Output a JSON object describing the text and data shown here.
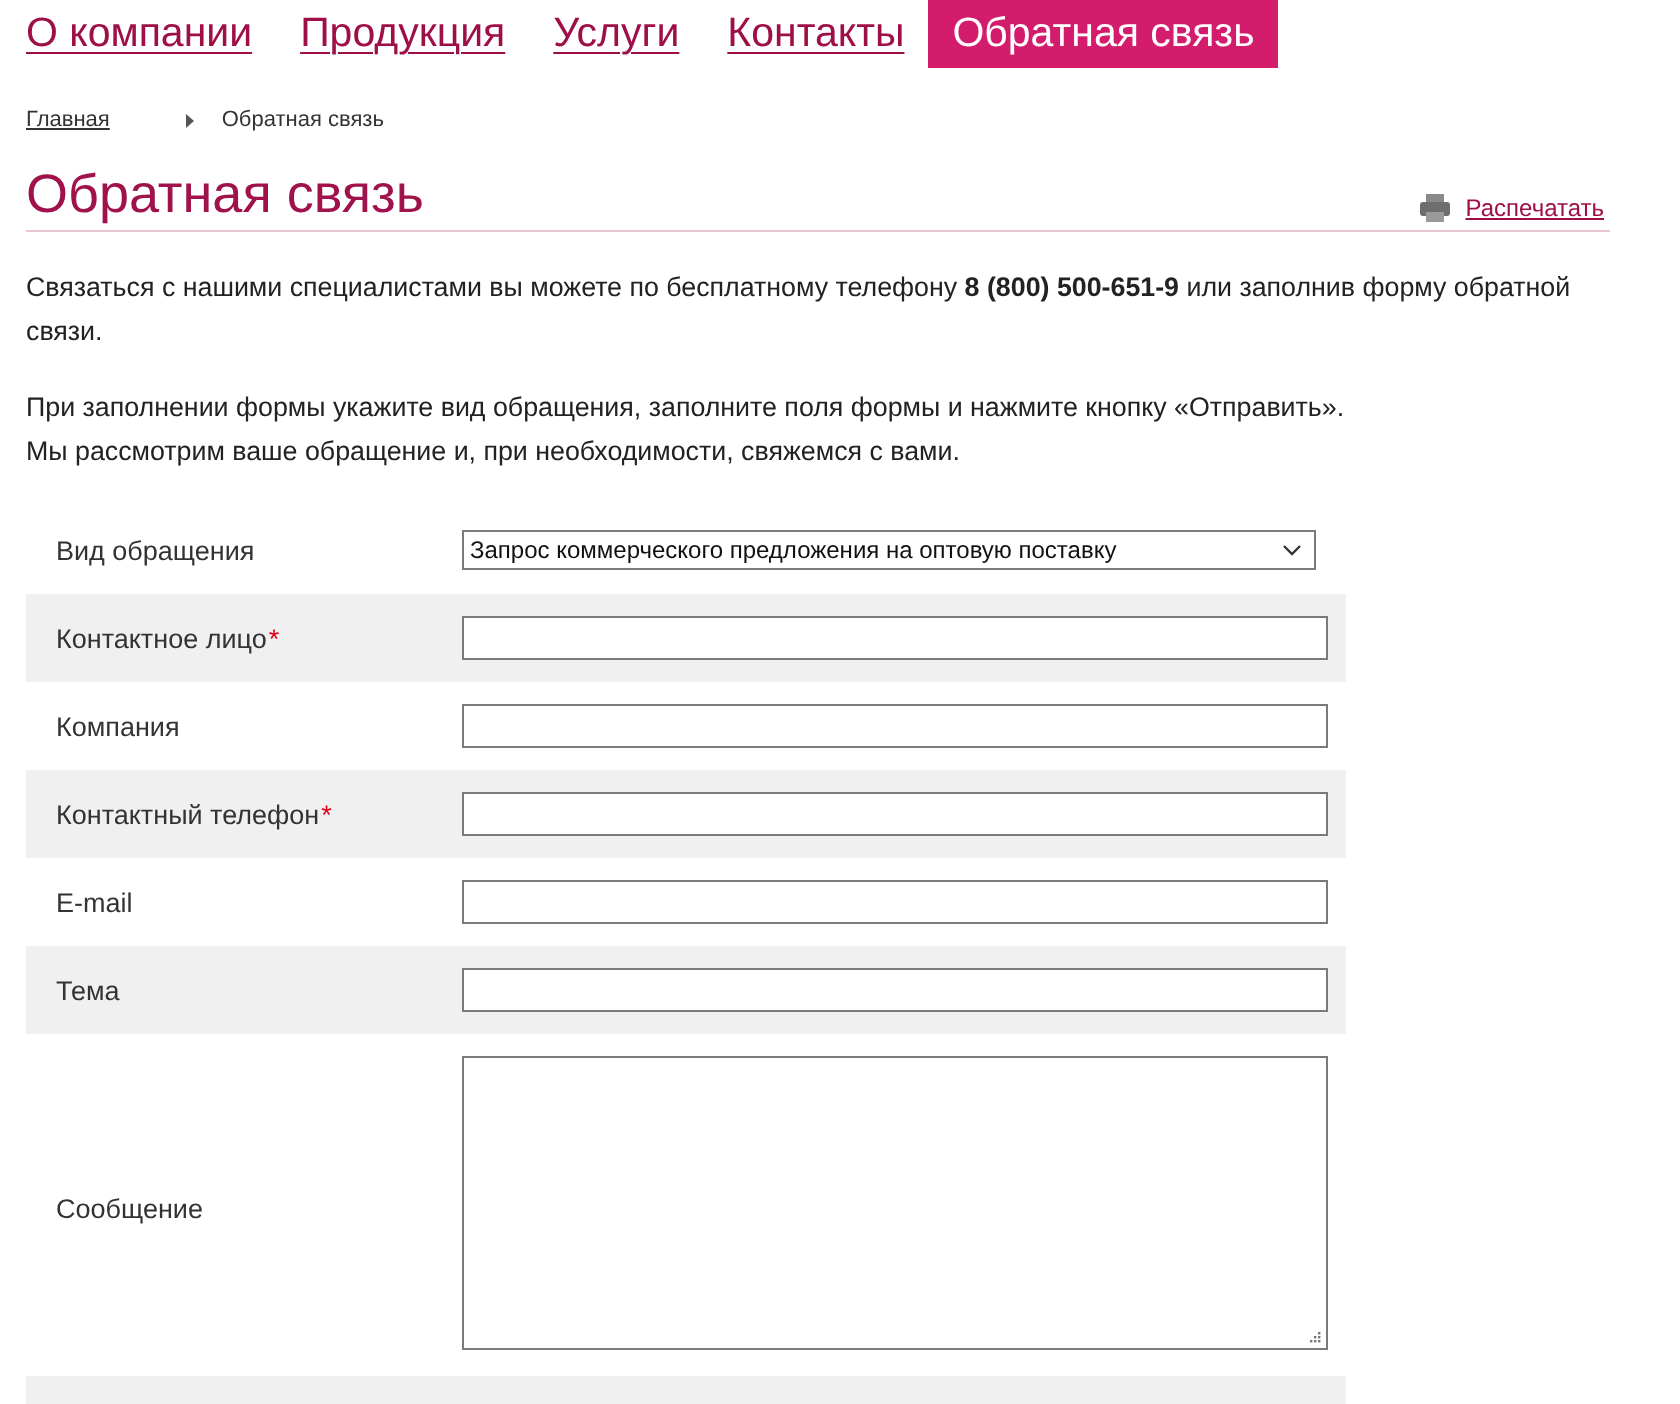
{
  "nav": {
    "items": [
      {
        "label": "О компании",
        "selected": false
      },
      {
        "label": "Продукция",
        "selected": false
      },
      {
        "label": "Услуги",
        "selected": false
      },
      {
        "label": "Контакты",
        "selected": false
      },
      {
        "label": "Обратная связь",
        "selected": true
      }
    ]
  },
  "breadcrumbs": [
    {
      "label": "Главная",
      "kind": "link"
    },
    {
      "label": "Обратная связь",
      "kind": "current"
    }
  ],
  "page": {
    "title": "Обратная связь",
    "print_link": "Распечатать"
  },
  "intro": [
    [
      "Связаться с нашими специалистами вы можете по бесплатному телефону **8 (800) 500-651-9** или заполнив форму обратной связи."
    ],
    [
      "При заполнении формы укажите вид обращения, заполните поля формы и нажмите кнопку «Отправить».",
      "Мы рассмотрим ваше обращение и, при необходимости, свяжемся с вами."
    ]
  ],
  "form": {
    "required_mark": "*",
    "fields": [
      {
        "label": "Вид обращения",
        "kind": "select",
        "required": false,
        "value": "Запрос коммерческого предложения на оптовую поставку"
      },
      {
        "label": "Контактное лицо",
        "kind": "text",
        "required": true
      },
      {
        "label": "Компания",
        "kind": "text",
        "required": false
      },
      {
        "label": "Контактный телефон",
        "kind": "text",
        "required": true
      },
      {
        "label": "E-mail",
        "kind": "text",
        "required": false
      },
      {
        "label": "Тема",
        "kind": "text",
        "required": false
      },
      {
        "label": "Сообщение",
        "kind": "textarea",
        "required": false
      }
    ]
  }
}
